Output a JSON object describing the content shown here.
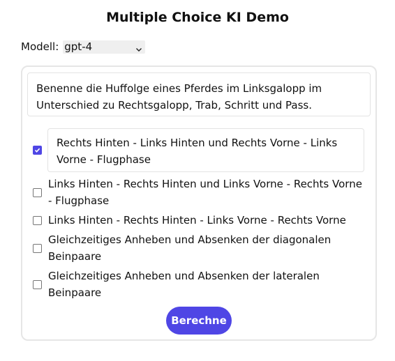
{
  "page": {
    "title": "Multiple Choice KI Demo"
  },
  "model": {
    "label": "Modell:",
    "selected": "gpt-4",
    "chevron_icon": "chevron-down-icon"
  },
  "question": {
    "text": "Benenne die Huffolge eines Pferdes im Linksgalopp im Unterschied zu Rechtsgalopp, Trab, Schritt und Pass."
  },
  "options": [
    {
      "text": "Rechts Hinten - Links Hinten und Rechts Vorne - Links Vorne - Flugphase",
      "checked": true
    },
    {
      "text": "Links Hinten - Rechts Hinten und Links Vorne - Rechts Vorne - Flugphase",
      "checked": false
    },
    {
      "text": "Links Hinten - Rechts Hinten - Links Vorne - Rechts Vorne",
      "checked": false
    },
    {
      "text": "Gleichzeitiges Anheben und Absenken der diagonalen Beinpaare",
      "checked": false
    },
    {
      "text": "Gleichzeitiges Anheben und Absenken der lateralen Beinpaare",
      "checked": false
    }
  ],
  "submit": {
    "label": "Berechne"
  },
  "colors": {
    "accent": "#4f46e5",
    "card_border": "#e6e6e6",
    "select_bg": "#efefef"
  }
}
